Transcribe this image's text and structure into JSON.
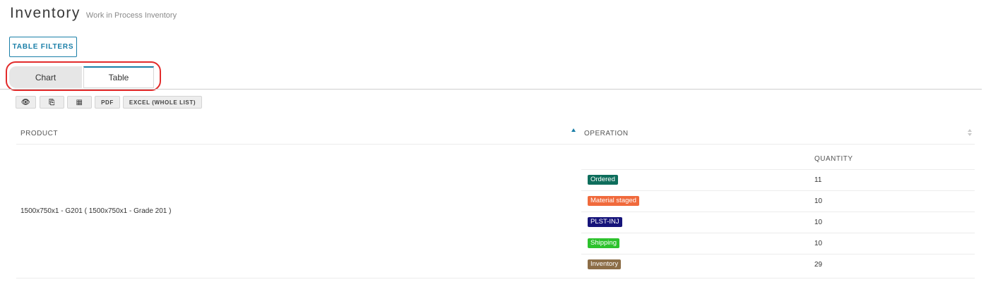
{
  "header": {
    "title": "Inventory",
    "subtitle": "Work in Process Inventory"
  },
  "filters_button": "TABLE FILTERS",
  "tabs": [
    {
      "label": "Chart",
      "active": false
    },
    {
      "label": "Table",
      "active": true
    }
  ],
  "toolbar": {
    "items": [
      {
        "icon": "eye-icon",
        "glyph": "👁"
      },
      {
        "icon": "copy-icon",
        "glyph": "⎘"
      },
      {
        "icon": "columns-icon",
        "glyph": "▦"
      },
      {
        "label": "PDF"
      },
      {
        "label": "EXCEL (WHOLE LIST)"
      }
    ]
  },
  "table": {
    "columns": {
      "product": "PRODUCT",
      "operation": "OPERATION",
      "quantity": "QUANTITY"
    },
    "rows": [
      {
        "product": "1500x750x1 - G201 ( 1500x750x1 - Grade 201 )",
        "operations": [
          {
            "label": "Ordered",
            "color": "#0e6e5c",
            "quantity": "11"
          },
          {
            "label": "Material staged",
            "color": "#f06a3c",
            "quantity": "10"
          },
          {
            "label": "PLST-INJ",
            "color": "#16147a",
            "quantity": "10"
          },
          {
            "label": "Shipping",
            "color": "#2cc22c",
            "quantity": "10"
          },
          {
            "label": "Inventory",
            "color": "#8c6d47",
            "quantity": "29"
          }
        ]
      }
    ]
  }
}
